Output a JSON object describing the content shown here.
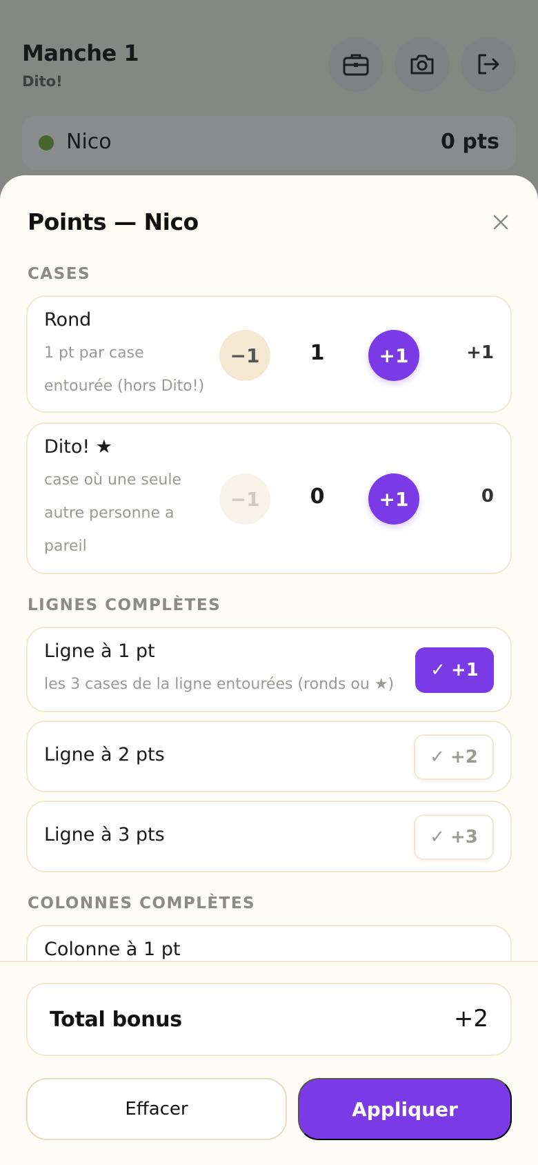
{
  "background": {
    "title": "Manche 1",
    "subtitle": "Dito!",
    "icons": [
      "briefcase-icon",
      "camera-icon",
      "exit-icon"
    ],
    "player": {
      "name": "Nico",
      "score": "0 pts",
      "color": "#7cb342"
    }
  },
  "sheet": {
    "title": "Points — Nico",
    "sections": {
      "cases": "CASES",
      "lines": "LIGNES COMPLÈTES",
      "columns": "COLONNES COMPLÈTES"
    },
    "cases": [
      {
        "title": "Rond",
        "desc": [
          "1 pt par case",
          "entourée (hors Dito!)"
        ],
        "minus": "−1",
        "value": "1",
        "plus": "+1",
        "result": "+1",
        "minus_enabled": true
      },
      {
        "title": "Dito! ★",
        "desc": [
          "case où une seule",
          "autre personne a",
          "pareil"
        ],
        "minus": "−1",
        "value": "0",
        "plus": "+1",
        "result": "0",
        "minus_enabled": false
      }
    ],
    "lines": [
      {
        "title": "Ligne à 1 pt",
        "desc": "les 3 cases de la ligne entourées (ronds ou ★)",
        "check": "✓",
        "label": "+1",
        "active": true
      },
      {
        "title": "Ligne à 2 pts",
        "check": "✓",
        "label": "+2",
        "active": false
      },
      {
        "title": "Ligne à 3 pts",
        "check": "✓",
        "label": "+3",
        "active": false
      }
    ],
    "columns": [
      {
        "title": "Colonne à 1 pt"
      }
    ]
  },
  "footer": {
    "total_label": "Total bonus",
    "total_value": "+2",
    "clear_label": "Effacer",
    "apply_label": "Appliquer"
  },
  "colors": {
    "accent": "#7a3ae6",
    "background": "#fefdf5",
    "border": "#f1e8cf"
  }
}
